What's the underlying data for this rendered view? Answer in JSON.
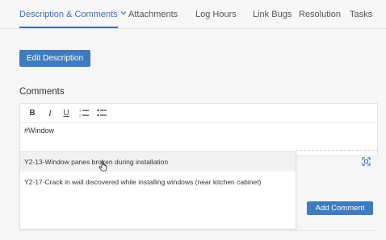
{
  "tabs": [
    {
      "label": "Description & Comments",
      "active": true
    },
    {
      "label": "Attachments"
    },
    {
      "label": "Log Hours"
    },
    {
      "label": "Link Bugs"
    },
    {
      "label": "Resolution"
    },
    {
      "label": "Tasks"
    }
  ],
  "edit_description_label": "Edit Description",
  "comments": {
    "title": "Comments",
    "toolbar": {
      "bold": "B",
      "italic": "I",
      "underline": "U"
    },
    "text": "#Window",
    "suggestions": [
      "Y2-13-Window panes broken during installation",
      "Y2-17-Crack in wall discovered while installing windows (near kitchen cabinet)"
    ],
    "add_comment_label": "Add Comment"
  },
  "colors": {
    "accent": "#3f7bbf",
    "active_tab": "#3d6fb0"
  },
  "icons": [
    "chevron-down-icon",
    "ordered-list-icon",
    "bullet-list-icon",
    "expand-icon",
    "hand-cursor-icon"
  ]
}
